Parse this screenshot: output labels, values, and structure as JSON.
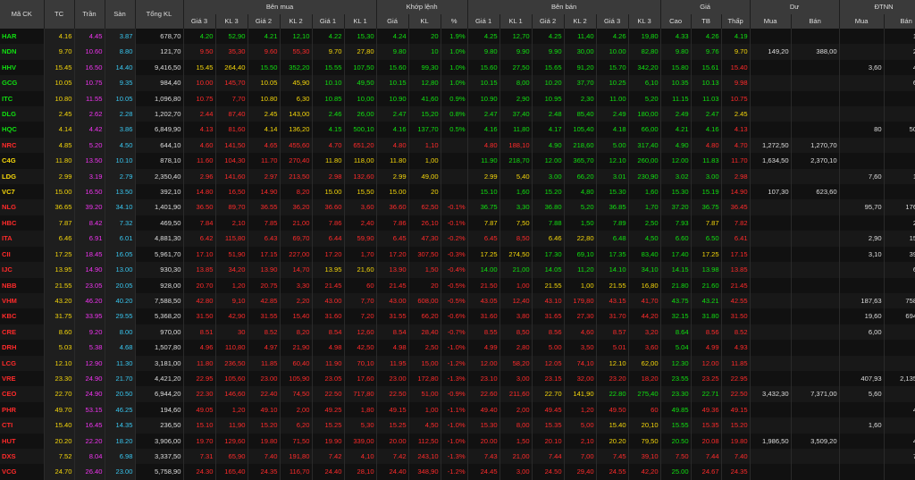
{
  "colors": {
    "ref": "#f5d60a",
    "ceiling": "#f033f0",
    "floor": "#38c6f0",
    "up": "#10e010",
    "down": "#ff2a2a",
    "neutral": "#dedede"
  },
  "header": {
    "groups": {
      "bid": "Bên mua",
      "match": "Khớp lệnh",
      "ask": "Bên bán",
      "price": "Giá",
      "resid": "Dư",
      "foreign": "ĐTNN"
    },
    "cols": {
      "symbol": "Mã CK",
      "ref": "TC",
      "ceil": "Trần",
      "floor": "Sàn",
      "total_vol": "Tổng KL",
      "bid_p3": "Giá 3",
      "bid_v3": "KL 3",
      "bid_p2": "Giá 2",
      "bid_v2": "KL 2",
      "bid_p1": "Giá 1",
      "bid_v1": "KL 1",
      "match_p": "Giá",
      "match_v": "KL",
      "match_pct": "%",
      "ask_p1": "Giá 1",
      "ask_v1": "KL 1",
      "ask_p2": "Giá 2",
      "ask_v2": "KL 2",
      "ask_p3": "Giá 3",
      "ask_v3": "KL 3",
      "high": "Cao",
      "avg": "TB",
      "low": "Thấp",
      "resid_buy": "Mua",
      "resid_sell": "Bán",
      "for_buy": "Mua",
      "for_sell": "Bán"
    }
  },
  "rows": [
    {
      "s": "HAR",
      "tc": "4.16",
      "tr": "4.45",
      "sa": "3.87",
      "tkl": "678,70",
      "b": [
        "4.20",
        "52,90",
        "4.21",
        "12,10",
        "4.22",
        "15,30"
      ],
      "m": [
        "4.24",
        "20",
        "1.9%"
      ],
      "a": [
        "4.25",
        "12,70",
        "4.25",
        "11,40",
        "4.26",
        "19,80"
      ],
      "hi": "4.33",
      "av": "4.26",
      "lo": "4.19",
      "dm": "",
      "db": "",
      "nm": "",
      "nb": "1,00"
    },
    {
      "s": "NDN",
      "tc": "9.70",
      "tr": "10.60",
      "sa": "8.80",
      "tkl": "121,70",
      "b": [
        "9.50",
        "35,30",
        "9.60",
        "55,30",
        "9.70",
        "27,80"
      ],
      "m": [
        "9.80",
        "10",
        "1.0%"
      ],
      "a": [
        "9.80",
        "9.90",
        "9.90",
        "30,00",
        "10.00",
        "82,80"
      ],
      "hi": "9.80",
      "av": "9.76",
      "lo": "9.70",
      "dm": "149,20",
      "db": "388,00",
      "nm": "",
      "nb": "2,00"
    },
    {
      "s": "HHV",
      "tc": "15.45",
      "tr": "16.50",
      "sa": "14.40",
      "tkl": "9,416,50",
      "b": [
        "15.45",
        "264,40",
        "15.50",
        "352,20",
        "15.55",
        "107,50"
      ],
      "m": [
        "15.60",
        "99,30",
        "1.0%"
      ],
      "a": [
        "15.60",
        "27,50",
        "15.65",
        "91,20",
        "15.70",
        "342,20"
      ],
      "hi": "15.80",
      "av": "15.61",
      "lo": "15.40",
      "dm": "",
      "db": "",
      "nm": "3,60",
      "nb": "4,70"
    },
    {
      "s": "GCG",
      "tc": "10.05",
      "tr": "10.75",
      "sa": "9.35",
      "tkl": "984,40",
      "b": [
        "10.00",
        "145,70",
        "10.05",
        "45,90",
        "10.10",
        "49,50"
      ],
      "m": [
        "10.15",
        "12,80",
        "1.0%"
      ],
      "a": [
        "10.15",
        "8,00",
        "10.20",
        "37,70",
        "10.25",
        "6,10"
      ],
      "hi": "10.35",
      "av": "10.13",
      "lo": "9.98",
      "dm": "",
      "db": "",
      "nm": "",
      "nb": "6,30"
    },
    {
      "s": "ITC",
      "tc": "10.80",
      "tr": "11.55",
      "sa": "10.05",
      "tkl": "1,096,80",
      "b": [
        "10.75",
        "7,70",
        "10.80",
        "6,30",
        "10.85",
        "10,00"
      ],
      "m": [
        "10.90",
        "41,60",
        "0.9%"
      ],
      "a": [
        "10.90",
        "2,90",
        "10.95",
        "2,30",
        "11.00",
        "5,20"
      ],
      "hi": "11.15",
      "av": "11.03",
      "lo": "10.75",
      "dm": "",
      "db": "",
      "nm": "",
      "nb": ""
    },
    {
      "s": "DLG",
      "tc": "2.45",
      "tr": "2.62",
      "sa": "2.28",
      "tkl": "1,202,70",
      "b": [
        "2.44",
        "87,40",
        "2.45",
        "143,00",
        "2.46",
        "26,00"
      ],
      "m": [
        "2.47",
        "15,20",
        "0.8%"
      ],
      "a": [
        "2.47",
        "37,40",
        "2.48",
        "85,40",
        "2.49",
        "180,00"
      ],
      "hi": "2.49",
      "av": "2.47",
      "lo": "2.45",
      "dm": "",
      "db": "",
      "nm": "",
      "nb": ""
    },
    {
      "s": "HQC",
      "tc": "4.14",
      "tr": "4.42",
      "sa": "3.86",
      "tkl": "6,849,90",
      "b": [
        "4.13",
        "81,60",
        "4.14",
        "136,20",
        "4.15",
        "500,10"
      ],
      "m": [
        "4.16",
        "137,70",
        "0.5%"
      ],
      "a": [
        "4.16",
        "11,80",
        "4.17",
        "105,40",
        "4.18",
        "66,00"
      ],
      "hi": "4.21",
      "av": "4.16",
      "lo": "4.13",
      "dm": "",
      "db": "",
      "nm": "80",
      "nb": "50,40"
    },
    {
      "s": "NRC",
      "tc": "4.85",
      "tr": "5.20",
      "sa": "4.50",
      "tkl": "644,10",
      "b": [
        "4.60",
        "141,50",
        "4.65",
        "455,60",
        "4.70",
        "651,20"
      ],
      "m": [
        "4.80",
        "1,10",
        ""
      ],
      "a": [
        "4.80",
        "188,10",
        "4.90",
        "218,60",
        "5.00",
        "317,40"
      ],
      "hi": "4.90",
      "av": "4.80",
      "lo": "4.70",
      "dm": "1,272,50",
      "db": "1,270,70",
      "nm": "",
      "nb": ""
    },
    {
      "s": "C4G",
      "tc": "11.80",
      "tr": "13.50",
      "sa": "10.10",
      "tkl": "878,10",
      "b": [
        "11.60",
        "104,30",
        "11.70",
        "270,40",
        "11.80",
        "118,00"
      ],
      "m": [
        "11.80",
        "1,00",
        ""
      ],
      "a": [
        "11.90",
        "218,70",
        "12.00",
        "365,70",
        "12.10",
        "260,00"
      ],
      "hi": "12.00",
      "av": "11.83",
      "lo": "11.70",
      "dm": "1,634,50",
      "db": "2,370,10",
      "nm": "",
      "nb": ""
    },
    {
      "s": "LDG",
      "tc": "2.99",
      "tr": "3.19",
      "sa": "2.79",
      "tkl": "2,350,40",
      "b": [
        "2.96",
        "141,60",
        "2.97",
        "213,50",
        "2.98",
        "132,60"
      ],
      "m": [
        "2.99",
        "49,00",
        ""
      ],
      "a": [
        "2.99",
        "5,40",
        "3.00",
        "66,20",
        "3.01",
        "230,90"
      ],
      "hi": "3.02",
      "av": "3.00",
      "lo": "2.98",
      "dm": "",
      "db": "",
      "nm": "7,60",
      "nb": "1,40"
    },
    {
      "s": "VC7",
      "tc": "15.00",
      "tr": "16.50",
      "sa": "13.50",
      "tkl": "392,10",
      "b": [
        "14.80",
        "16,50",
        "14.90",
        "8,20",
        "15.00",
        "15,50"
      ],
      "m": [
        "15.00",
        "20",
        ""
      ],
      "a": [
        "15.10",
        "1,60",
        "15.20",
        "4,80",
        "15.30",
        "1,60"
      ],
      "hi": "15.30",
      "av": "15.19",
      "lo": "14.90",
      "dm": "107,30",
      "db": "623,60",
      "nm": "",
      "nb": ""
    },
    {
      "s": "NLG",
      "tc": "36.65",
      "tr": "39.20",
      "sa": "34.10",
      "tkl": "1,401,90",
      "b": [
        "36.50",
        "89,70",
        "36.55",
        "36,20",
        "36.60",
        "3,60"
      ],
      "m": [
        "36.60",
        "62,50",
        "-0.1%"
      ],
      "a": [
        "36.75",
        "3,30",
        "36.80",
        "5,20",
        "36.85",
        "1,70"
      ],
      "hi": "37.20",
      "av": "36.75",
      "lo": "36.45",
      "dm": "",
      "db": "",
      "nm": "95,70",
      "nb": "176,00"
    },
    {
      "s": "HBC",
      "tc": "7.87",
      "tr": "8.42",
      "sa": "7.32",
      "tkl": "469,50",
      "b": [
        "7.84",
        "2,10",
        "7.85",
        "21,00",
        "7.86",
        "2,40"
      ],
      "m": [
        "7.86",
        "26,10",
        "-0.1%"
      ],
      "a": [
        "7.87",
        "7,50",
        "7.88",
        "1,50",
        "7.89",
        "2,50"
      ],
      "hi": "7.93",
      "av": "7.87",
      "lo": "7.82",
      "dm": "",
      "db": "",
      "nm": "",
      "nb": "2,00"
    },
    {
      "s": "ITA",
      "tc": "6.46",
      "tr": "6.91",
      "sa": "6.01",
      "tkl": "4,881,30",
      "b": [
        "6.42",
        "115,80",
        "6.43",
        "69,70",
        "6.44",
        "59,90"
      ],
      "m": [
        "6.45",
        "47,30",
        "-0.2%"
      ],
      "a": [
        "6.45",
        "8,50",
        "6.46",
        "22,80",
        "6.48",
        "4,50"
      ],
      "hi": "6.60",
      "av": "6.50",
      "lo": "6.41",
      "dm": "",
      "db": "",
      "nm": "2,90",
      "nb": "15,90"
    },
    {
      "s": "CII",
      "tc": "17.25",
      "tr": "18.45",
      "sa": "16.05",
      "tkl": "5,961,70",
      "b": [
        "17.10",
        "51,90",
        "17.15",
        "227,00",
        "17.20",
        "1,70"
      ],
      "m": [
        "17.20",
        "307,50",
        "-0.3%"
      ],
      "a": [
        "17.25",
        "274,50",
        "17.30",
        "69,10",
        "17.35",
        "83,40"
      ],
      "hi": "17.40",
      "av": "17.25",
      "lo": "17.15",
      "dm": "",
      "db": "",
      "nm": "3,10",
      "nb": "39,60"
    },
    {
      "s": "IJC",
      "tc": "13.95",
      "tr": "14.90",
      "sa": "13.00",
      "tkl": "930,30",
      "b": [
        "13.85",
        "34,20",
        "13.90",
        "14,70",
        "13.95",
        "21,60"
      ],
      "m": [
        "13.90",
        "1,50",
        "-0.4%"
      ],
      "a": [
        "14.00",
        "21,00",
        "14.05",
        "11,20",
        "14.10",
        "34,10"
      ],
      "hi": "14.15",
      "av": "13.98",
      "lo": "13.85",
      "dm": "",
      "db": "",
      "nm": "",
      "nb": "6,00"
    },
    {
      "s": "NBB",
      "tc": "21.55",
      "tr": "23.05",
      "sa": "20.05",
      "tkl": "928,00",
      "b": [
        "20.70",
        "1,20",
        "20.75",
        "3,30",
        "21.45",
        "60"
      ],
      "m": [
        "21.45",
        "20",
        "-0.5%"
      ],
      "a": [
        "21.50",
        "1,00",
        "21.55",
        "1,00",
        "21.55",
        "16,80"
      ],
      "hi": "21.80",
      "av": "21.60",
      "lo": "21.45",
      "dm": "",
      "db": "",
      "nm": "",
      "nb": ""
    },
    {
      "s": "VHM",
      "tc": "43.20",
      "tr": "46.20",
      "sa": "40.20",
      "tkl": "7,588,50",
      "b": [
        "42.80",
        "9,10",
        "42.85",
        "2,20",
        "43.00",
        "7,70"
      ],
      "m": [
        "43.00",
        "608,00",
        "-0.5%"
      ],
      "a": [
        "43.05",
        "12,40",
        "43.10",
        "179,80",
        "43.15",
        "41,70"
      ],
      "hi": "43.75",
      "av": "43.21",
      "lo": "42.55",
      "dm": "",
      "db": "",
      "nm": "187,63",
      "nb": "758,58"
    },
    {
      "s": "KBC",
      "tc": "31.75",
      "tr": "33.95",
      "sa": "29.55",
      "tkl": "5,368,20",
      "b": [
        "31.50",
        "42,90",
        "31.55",
        "15,40",
        "31.60",
        "7,20"
      ],
      "m": [
        "31.55",
        "66,20",
        "-0.6%"
      ],
      "a": [
        "31.60",
        "3,80",
        "31.65",
        "27,30",
        "31.70",
        "44,20"
      ],
      "hi": "32.15",
      "av": "31.80",
      "lo": "31.50",
      "dm": "",
      "db": "",
      "nm": "19,60",
      "nb": "694,10"
    },
    {
      "s": "CRE",
      "tc": "8.60",
      "tr": "9.20",
      "sa": "8.00",
      "tkl": "970,00",
      "b": [
        "8.51",
        "30",
        "8.52",
        "8,20",
        "8.54",
        "12,60"
      ],
      "m": [
        "8.54",
        "28,40",
        "-0.7%"
      ],
      "a": [
        "8.55",
        "8,50",
        "8.56",
        "4,60",
        "8.57",
        "3,20"
      ],
      "hi": "8.64",
      "av": "8.56",
      "lo": "8.52",
      "dm": "",
      "db": "",
      "nm": "6,00",
      "nb": ""
    },
    {
      "s": "DRH",
      "tc": "5.03",
      "tr": "5.38",
      "sa": "4.68",
      "tkl": "1,507,80",
      "b": [
        "4.96",
        "110,80",
        "4.97",
        "21,90",
        "4.98",
        "42,50"
      ],
      "m": [
        "4.98",
        "2,50",
        "-1.0%"
      ],
      "a": [
        "4.99",
        "2,80",
        "5.00",
        "3,50",
        "5.01",
        "3,60"
      ],
      "hi": "5.04",
      "av": "4.99",
      "lo": "4.93",
      "dm": "",
      "db": "",
      "nm": "",
      "nb": ""
    },
    {
      "s": "LCG",
      "tc": "12.10",
      "tr": "12.90",
      "sa": "11.30",
      "tkl": "3,181,00",
      "b": [
        "11.80",
        "236,50",
        "11.85",
        "60,40",
        "11.90",
        "70,10"
      ],
      "m": [
        "11.95",
        "15,00",
        "-1.2%"
      ],
      "a": [
        "12.00",
        "58,20",
        "12.05",
        "74,10",
        "12.10",
        "62,00"
      ],
      "hi": "12.30",
      "av": "12.00",
      "lo": "11.85",
      "dm": "",
      "db": "",
      "nm": "",
      "nb": ""
    },
    {
      "s": "VRE",
      "tc": "23.30",
      "tr": "24.90",
      "sa": "21.70",
      "tkl": "4,421,20",
      "b": [
        "22.95",
        "105,60",
        "23.00",
        "105,90",
        "23.05",
        "17,60"
      ],
      "m": [
        "23.00",
        "172,80",
        "-1.3%"
      ],
      "a": [
        "23.10",
        "3,00",
        "23.15",
        "32,00",
        "23.20",
        "18,20"
      ],
      "hi": "23.55",
      "av": "23.25",
      "lo": "22.95",
      "dm": "",
      "db": "",
      "nm": "407,93",
      "nb": "2,135,50"
    },
    {
      "s": "CEO",
      "tc": "22.70",
      "tr": "24.90",
      "sa": "20.50",
      "tkl": "6,944,20",
      "b": [
        "22.30",
        "146,60",
        "22.40",
        "74,50",
        "22.50",
        "717,80"
      ],
      "m": [
        "22.50",
        "51,00",
        "-0.9%"
      ],
      "a": [
        "22.60",
        "211,60",
        "22.70",
        "141,90",
        "22.80",
        "275,40"
      ],
      "hi": "23.30",
      "av": "22.71",
      "lo": "22.50",
      "dm": "3,432,30",
      "db": "7,371,00",
      "nm": "5,60",
      "nb": ""
    },
    {
      "s": "PHR",
      "tc": "49.70",
      "tr": "53.15",
      "sa": "46.25",
      "tkl": "194,60",
      "b": [
        "49.05",
        "1,20",
        "49.10",
        "2,00",
        "49.25",
        "1,80"
      ],
      "m": [
        "49.15",
        "1,00",
        "-1.1%"
      ],
      "a": [
        "49.40",
        "2,00",
        "49.45",
        "1,20",
        "49.50",
        "60"
      ],
      "hi": "49.85",
      "av": "49.36",
      "lo": "49.15",
      "dm": "",
      "db": "",
      "nm": "",
      "nb": "4,90"
    },
    {
      "s": "CTI",
      "tc": "15.40",
      "tr": "16.45",
      "sa": "14.35",
      "tkl": "236,50",
      "b": [
        "15.10",
        "11,90",
        "15.20",
        "6,20",
        "15.25",
        "5,30"
      ],
      "m": [
        "15.25",
        "4,50",
        "-1.0%"
      ],
      "a": [
        "15.30",
        "8,00",
        "15.35",
        "5,00",
        "15.40",
        "20,10"
      ],
      "hi": "15.55",
      "av": "15.35",
      "lo": "15.20",
      "dm": "",
      "db": "",
      "nm": "1,60",
      "nb": ""
    },
    {
      "s": "HUT",
      "tc": "20.20",
      "tr": "22.20",
      "sa": "18.20",
      "tkl": "3,906,00",
      "b": [
        "19.70",
        "129,60",
        "19.80",
        "71,50",
        "19.90",
        "339,00"
      ],
      "m": [
        "20.00",
        "112,50",
        "-1.0%"
      ],
      "a": [
        "20.00",
        "1,50",
        "20.10",
        "2,10",
        "20.20",
        "79,50"
      ],
      "hi": "20.50",
      "av": "20.08",
      "lo": "19.80",
      "dm": "1,986,50",
      "db": "3,509,20",
      "nm": "",
      "nb": "4,90"
    },
    {
      "s": "DXS",
      "tc": "7.52",
      "tr": "8.04",
      "sa": "6.98",
      "tkl": "3,337,50",
      "b": [
        "7.31",
        "65,90",
        "7.40",
        "191,80",
        "7.42",
        "4,10"
      ],
      "m": [
        "7.42",
        "243,10",
        "-1.3%"
      ],
      "a": [
        "7.43",
        "21,00",
        "7.44",
        "7,00",
        "7.45",
        "39,10"
      ],
      "hi": "7.50",
      "av": "7.44",
      "lo": "7.40",
      "dm": "",
      "db": "",
      "nm": "",
      "nb": "7,90"
    },
    {
      "s": "VCG",
      "tc": "24.70",
      "tr": "26.40",
      "sa": "23.00",
      "tkl": "5,758,90",
      "b": [
        "24.30",
        "165,40",
        "24.35",
        "116,70",
        "24.40",
        "28,10"
      ],
      "m": [
        "24.40",
        "348,90",
        "-1.2%"
      ],
      "a": [
        "24.45",
        "3,00",
        "24.50",
        "29,40",
        "24.55",
        "42,20"
      ],
      "hi": "25.00",
      "av": "24.67",
      "lo": "24.35",
      "dm": "",
      "db": "",
      "nm": "",
      "nb": ""
    }
  ]
}
